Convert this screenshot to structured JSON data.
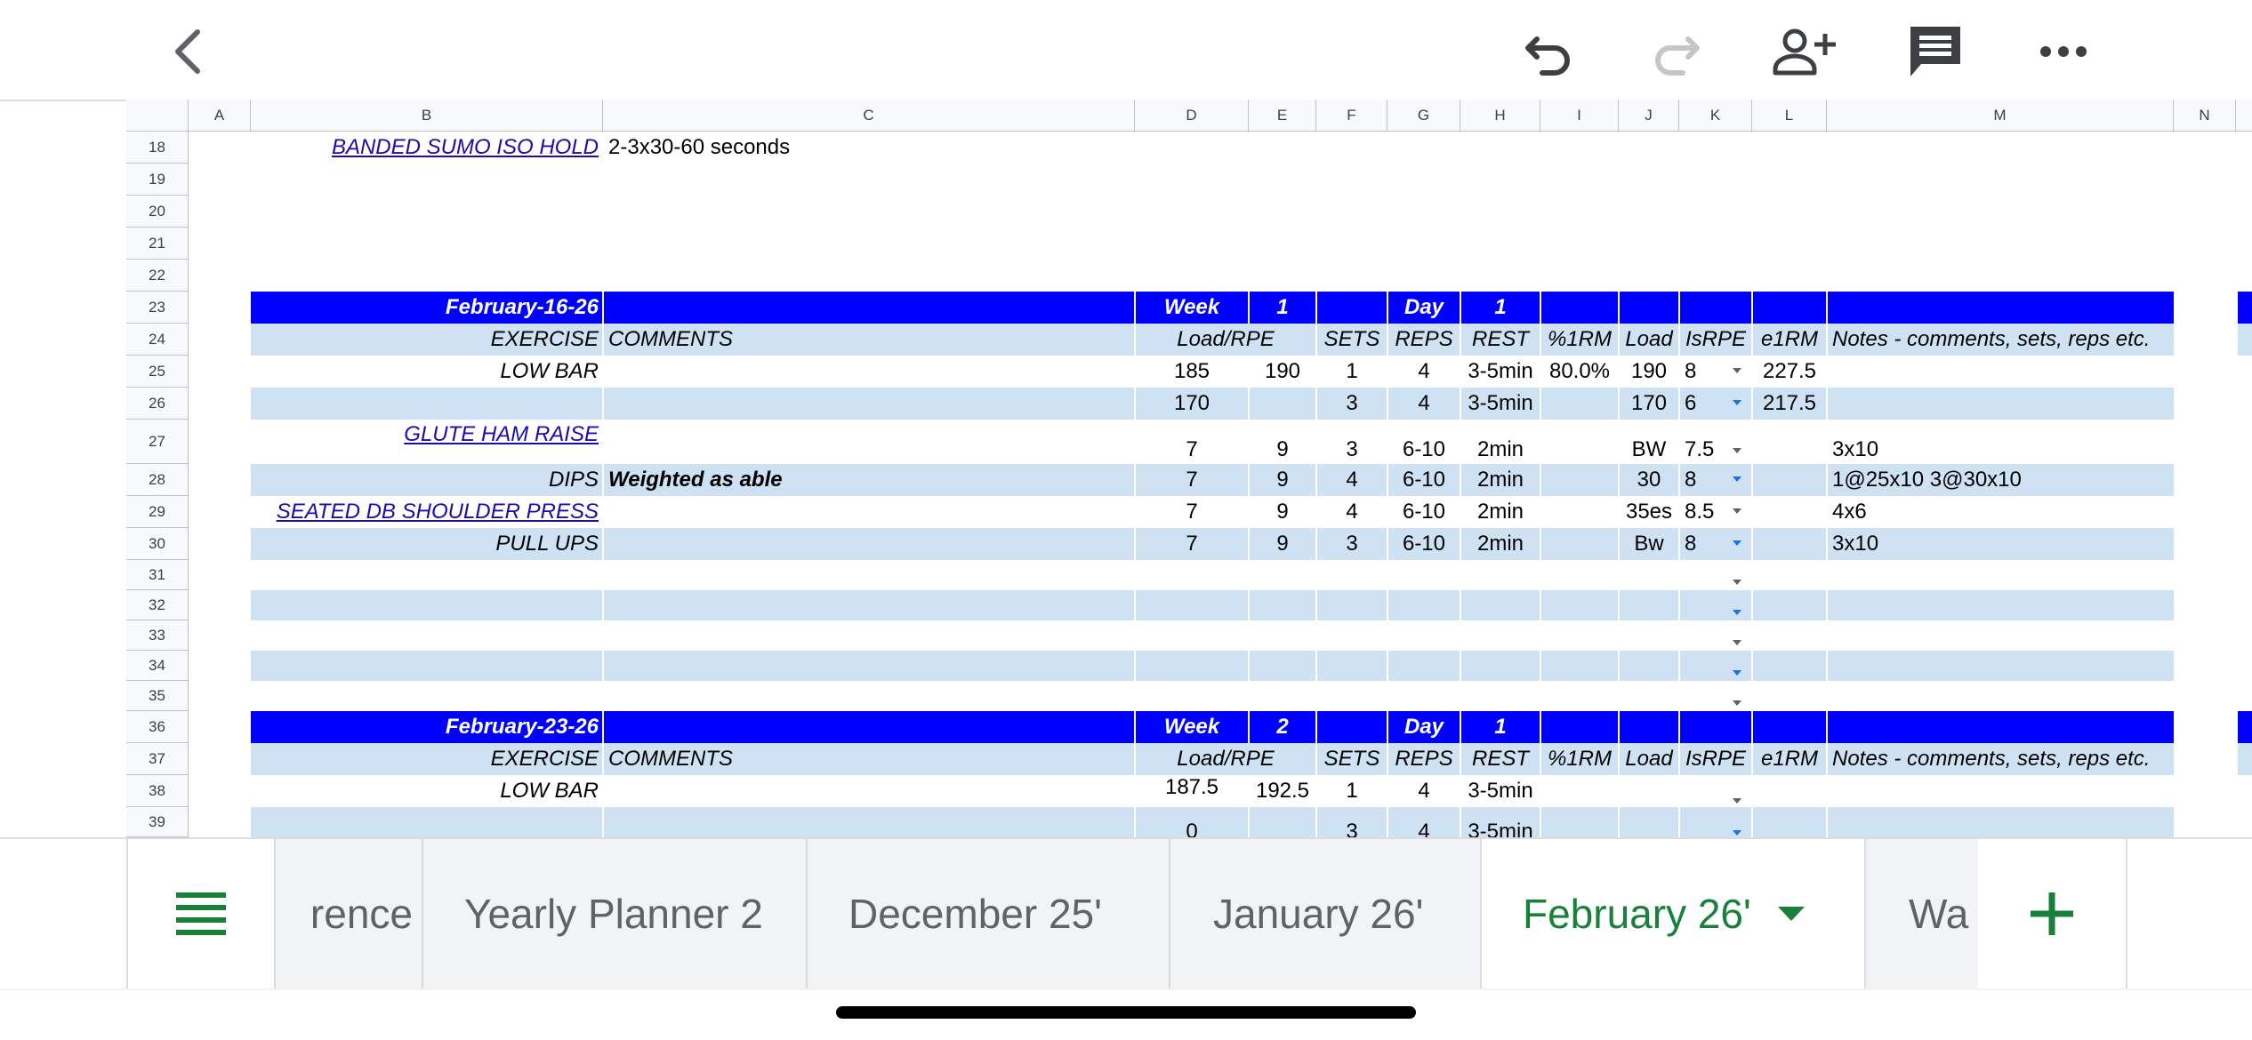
{
  "colors": {
    "header_fill": "#0000ff",
    "alt_row_fill": "#cfe2f3",
    "active_tab": "#188038",
    "link": "#1a0dab"
  },
  "toolbar": {
    "back_icon": "chevron-left-icon",
    "undo_icon": "undo-icon",
    "redo_icon": "redo-icon",
    "share_icon": "add-person-icon",
    "comment_icon": "comment-icon",
    "more_icon": "more-horizontal-icon"
  },
  "columns": [
    "A",
    "B",
    "C",
    "D",
    "E",
    "F",
    "G",
    "H",
    "I",
    "J",
    "K",
    "L",
    "M",
    "N"
  ],
  "rows": [
    "18",
    "19",
    "20",
    "21",
    "22",
    "23",
    "24",
    "25",
    "26",
    "27",
    "28",
    "29",
    "30",
    "31",
    "32",
    "33",
    "34",
    "35",
    "36",
    "37",
    "38",
    "39"
  ],
  "sheet": {
    "r18": {
      "b": "BANDED SUMO ISO HOLD",
      "c": "2-3x30-60 seconds"
    },
    "block1": {
      "date": "February-16-26",
      "week_label": "Week",
      "week": "1",
      "day_label": "Day",
      "day": "1"
    },
    "header1": {
      "exercise": "EXERCISE",
      "comments": "COMMENTS",
      "load_rpe": "Load/RPE",
      "sets": "SETS",
      "reps": "REPS",
      "rest": "REST",
      "pct1rm": "%1RM",
      "load": "Load",
      "isrpe": "IsRPE",
      "e1rm": "e1RM",
      "notes": "Notes - comments, sets, reps etc."
    },
    "r25": {
      "b": "LOW BAR",
      "d": "185",
      "e": "190",
      "f": "1",
      "g": "4",
      "h": "3-5min",
      "i": "80.0%",
      "j": "190",
      "k": "8",
      "l": "227.5"
    },
    "r26": {
      "d": "170",
      "f": "3",
      "g": "4",
      "h": "3-5min",
      "j": "170",
      "k": "6",
      "l": "217.5"
    },
    "r27": {
      "b": "GLUTE HAM RAISE",
      "d": "7",
      "e": "9",
      "f": "3",
      "g": "6-10",
      "h": "2min",
      "j": "BW",
      "k": "7.5",
      "m": "3x10"
    },
    "r28": {
      "b": "DIPS",
      "c": "Weighted as able",
      "d": "7",
      "e": "9",
      "f": "4",
      "g": "6-10",
      "h": "2min",
      "j": "30",
      "k": "8",
      "m": "1@25x10 3@30x10"
    },
    "r29": {
      "b": "SEATED DB SHOULDER PRESS",
      "d": "7",
      "e": "9",
      "f": "4",
      "g": "6-10",
      "h": "2min",
      "j": "35es",
      "k": "8.5",
      "m": "4x6"
    },
    "r30": {
      "b": "PULL UPS",
      "d": "7",
      "e": "9",
      "f": "3",
      "g": "6-10",
      "h": "2min",
      "j": "Bw",
      "k": "8",
      "m": "3x10"
    },
    "block2": {
      "date": "February-23-26",
      "week_label": "Week",
      "week": "2",
      "day_label": "Day",
      "day": "1"
    },
    "header2": {
      "exercise": "EXERCISE",
      "comments": "COMMENTS",
      "load_rpe": "Load/RPE",
      "sets": "SETS",
      "reps": "REPS",
      "rest": "REST",
      "pct1rm": "%1RM",
      "load": "Load",
      "isrpe": "IsRPE",
      "e1rm": "e1RM",
      "notes": "Notes - comments, sets, reps etc."
    },
    "r38": {
      "b": "LOW BAR",
      "d": "187.5",
      "e": "192.5",
      "f": "1",
      "g": "4",
      "h": "3-5min"
    },
    "r39": {
      "d": "0",
      "f": "3",
      "g": "4",
      "h": "3-5min"
    }
  },
  "tabs": {
    "menu_icon": "sheets-list-icon",
    "items": [
      "rence",
      "Yearly Planner 2",
      "December 25'",
      "January 26'",
      "February 26'",
      "Wa"
    ],
    "active": "February 26'",
    "add_icon": "plus-icon"
  }
}
